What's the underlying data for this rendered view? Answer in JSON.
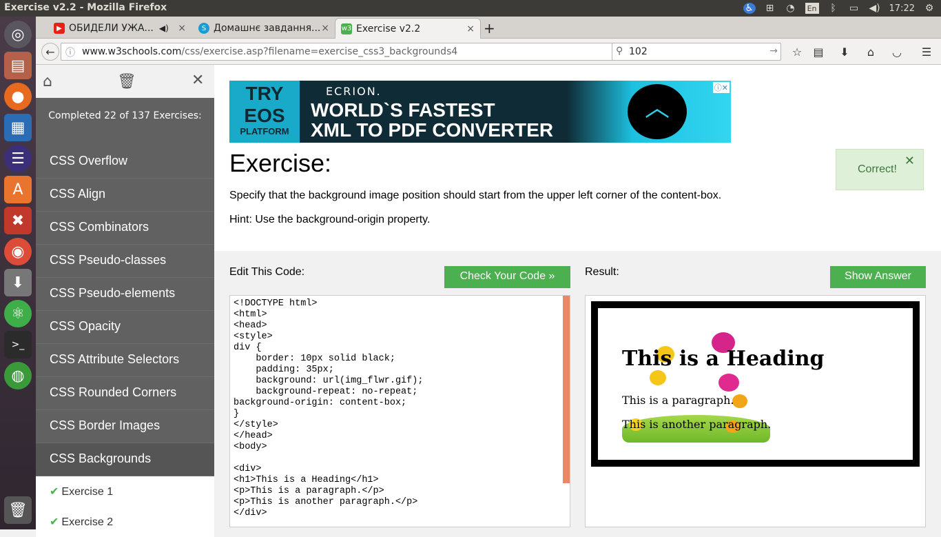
{
  "os": {
    "window_title": "Exercise v2.2 - Mozilla Firefox",
    "keyboard_layout": "En",
    "clock": "17:22"
  },
  "browser": {
    "tabs": [
      {
        "label": "ОБИДЕЛИ УЖА...",
        "icon": "youtube-icon",
        "color": "#e62117"
      },
      {
        "label": "Домашнє завдання...",
        "icon": "skype-icon",
        "color": "#1c9ad6"
      },
      {
        "label": "Exercise v2.2",
        "icon": "w3schools-icon",
        "color": "#4caf50"
      }
    ],
    "url_domain": "www.w3schools.com",
    "url_path": "/css/exercise.asp?filename=exercise_css3_backgrounds4",
    "search_value": "102"
  },
  "sidebar": {
    "progress": "Completed 22 of 137 Exercises:",
    "items": [
      "CSS Overflow",
      "CSS Align",
      "CSS Combinators",
      "CSS Pseudo-classes",
      "CSS Pseudo-elements",
      "CSS Opacity",
      "CSS Attribute Selectors",
      "CSS Rounded Corners",
      "CSS Border Images",
      "CSS Backgrounds"
    ],
    "exercises": [
      "Exercise 1",
      "Exercise 2"
    ]
  },
  "ad": {
    "left_line1": "TRY",
    "left_line2": "EOS",
    "left_line3": "PLATFORM",
    "brand": "ECRION.",
    "headline1": "WORLD`S FASTEST",
    "headline2": "XML TO PDF CONVERTER"
  },
  "exercise": {
    "title": "Exercise:",
    "description": "Specify that the background image position should start from the upper left corner of the content-box.",
    "hint": "Hint: Use the background-origin property.",
    "correct": "Correct!",
    "edit_label": "Edit This Code:",
    "check_button": "Check Your Code »",
    "result_label": "Result:",
    "show_answer": "Show Answer",
    "code": "<!DOCTYPE html>\n<html>\n<head>\n<style>\ndiv {\n    border: 10px solid black;\n    padding: 35px;\n    background: url(img_flwr.gif);\n    background-repeat: no-repeat;\nbackground-origin: content-box;\n}\n</style>\n</head>\n<body>\n\n<div>\n<h1>This is a Heading</h1>\n<p>This is a paragraph.</p>\n<p>This is another paragraph.</p>\n</div>"
  },
  "result": {
    "heading": "This is a Heading",
    "paragraph1": "This is a paragraph.",
    "paragraph2": "This is another paragraph."
  }
}
